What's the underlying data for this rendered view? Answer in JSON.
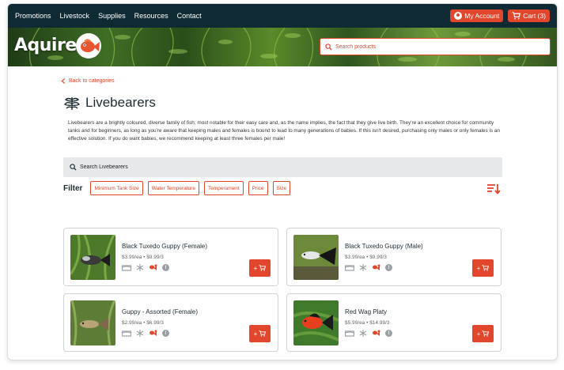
{
  "nav": {
    "items": [
      "Promotions",
      "Livestock",
      "Supplies",
      "Resources",
      "Contact"
    ],
    "account_label": "My Account",
    "cart_label": "Cart (3)"
  },
  "brand": {
    "logo": "Aquire"
  },
  "search": {
    "placeholder": "Search products"
  },
  "back_link": "Back to categories",
  "category": {
    "title": "Livebearers",
    "description": "Livebearers are a brightly coloured, diverse family of fish; most notable for their easy care and, as the name implies, the fact that they give live birth. They're an excellent choice for community tanks and for beginners, as long as you're aware that keeping males and females is bound to lead to many generations of babies. If this isn't desired, purchasing only males or only females is an effective solution. If you do want babies, we recommend keeping at least three females per male!"
  },
  "filter": {
    "search_placeholder": "Search Livebearers",
    "label": "Filter",
    "chips": [
      "Minimum Tank Size",
      "Water Temperature",
      "Temperament",
      "Price",
      "Size"
    ]
  },
  "products": [
    {
      "name": "Black Tuxedo Guppy (Female)",
      "price": "$3.99/ea • $9.99/3"
    },
    {
      "name": "Black Tuxedo Guppy (Male)",
      "price": "$3.99/ea • $9.99/3"
    },
    {
      "name": "Guppy - Assorted (Female)",
      "price": "$2.99/ea • $6.99/3"
    },
    {
      "name": "Red Wag Platy",
      "price": "$5.99/ea • $14.99/3"
    }
  ],
  "add_button": "+",
  "colors": {
    "accent": "#e2462d",
    "nav_bg": "#0f2a33",
    "text_dark": "#1d2c33"
  },
  "icons": [
    "user-icon",
    "cart-icon",
    "search-icon",
    "chevron-left-icon",
    "plant-icon",
    "sort-icon",
    "tank-size-icon",
    "temperature-icon",
    "temperament-icon",
    "info-icon"
  ]
}
